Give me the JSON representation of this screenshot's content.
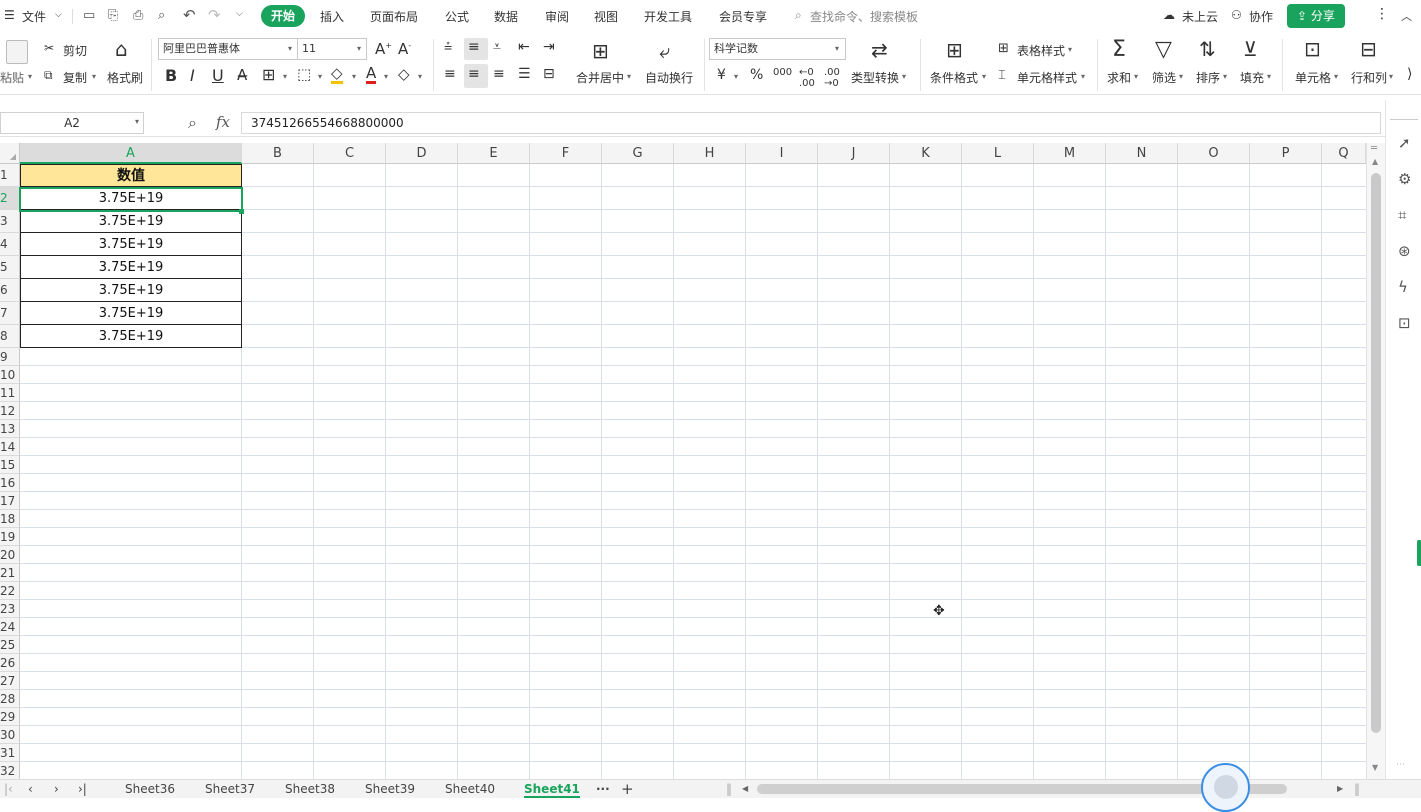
{
  "menu": {
    "file": "文件",
    "tabs": [
      "开始",
      "插入",
      "页面布局",
      "公式",
      "数据",
      "审阅",
      "视图",
      "开发工具",
      "会员专享"
    ],
    "search": "查找命令、搜索模板",
    "cloud": "未上云",
    "collab": "协作",
    "share": "分享"
  },
  "ribbon": {
    "paste": "粘贴",
    "cut": "剪切",
    "copy": "复制",
    "format_painter": "格式刷",
    "font_name": "阿里巴巴普惠体",
    "font_size": "11",
    "merge_center": "合并居中",
    "auto_wrap": "自动换行",
    "number_format": "科学记数",
    "type_convert": "类型转换",
    "cond_format": "条件格式",
    "table_style": "表格样式",
    "cell_style": "单元格样式",
    "sum": "求和",
    "filter": "筛选",
    "sort": "排序",
    "fill": "填充",
    "cell": "单元格",
    "row_col": "行和列",
    "bold": "B",
    "italic": "I",
    "underline": "U"
  },
  "formula_bar": {
    "name_box": "A2",
    "fx": "fx",
    "value": "37451266554668800000"
  },
  "columns": [
    "A",
    "B",
    "C",
    "D",
    "E",
    "F",
    "G",
    "H",
    "I",
    "J",
    "K",
    "L",
    "M",
    "N",
    "O",
    "P",
    "Q"
  ],
  "rows": [
    "1",
    "2",
    "3",
    "4",
    "5",
    "6",
    "7",
    "8",
    "9",
    "10",
    "11",
    "12",
    "13",
    "14",
    "15",
    "16",
    "17",
    "18",
    "19",
    "20",
    "21",
    "22",
    "23",
    "24",
    "25",
    "26",
    "27",
    "28",
    "29",
    "30",
    "31",
    "32"
  ],
  "cells": {
    "header": "数值",
    "values": [
      "3.75E+19",
      "3.75E+19",
      "3.75E+19",
      "3.75E+19",
      "3.75E+19",
      "3.75E+19",
      "3.75E+19"
    ]
  },
  "sheets": [
    "Sheet36",
    "Sheet37",
    "Sheet38",
    "Sheet39",
    "Sheet40",
    "Sheet41"
  ],
  "active_sheet": "Sheet41",
  "colors": {
    "accent": "#1aa35c",
    "header_fill": "#ffe699"
  }
}
